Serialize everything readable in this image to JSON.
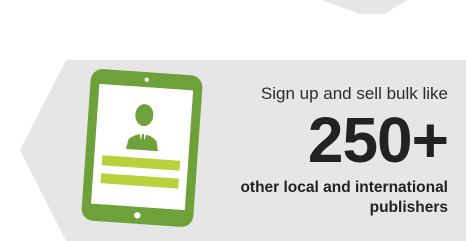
{
  "colors": {
    "panel": "#e6e6e6",
    "tablet_frame": "#6ea13a",
    "screen": "#ffffff",
    "bar": "#b7d23c",
    "person": "#6ea13a",
    "text": "#222222"
  },
  "icon": "tablet-with-user-icon",
  "promo": {
    "tagline": "Sign up and sell bulk like",
    "number": "250+",
    "subline_1": "other local and international",
    "subline_2": "publishers"
  }
}
